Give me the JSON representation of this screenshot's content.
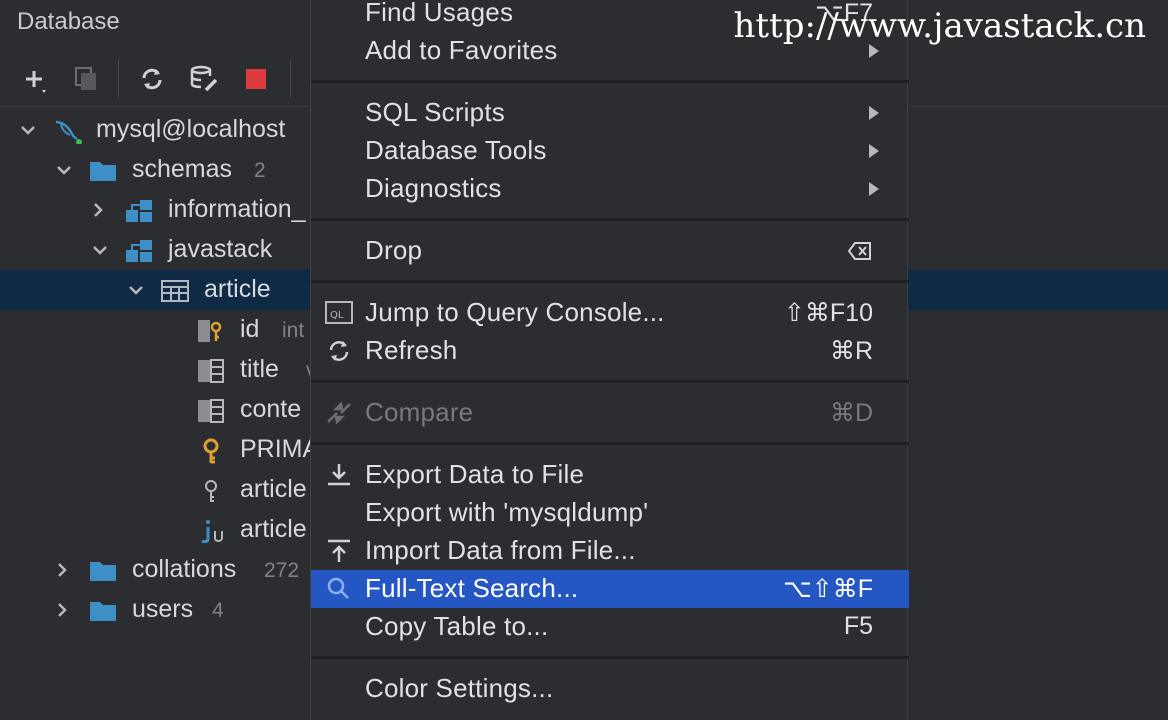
{
  "panel": {
    "title": "Database"
  },
  "watermark": "http://www.javastack.cn",
  "tree": {
    "connection": "mysql@localhost",
    "schemas": {
      "label": "schemas",
      "count": "2"
    },
    "information_schema": "information_",
    "javastack": "javastack",
    "article": "article",
    "columns": [
      {
        "label": "id",
        "type": "int"
      },
      {
        "label": "title",
        "type": "v"
      },
      {
        "label": "conte",
        "type": ""
      }
    ],
    "primary_key": "PRIMA",
    "index1": "article",
    "index2": "article",
    "collations": {
      "label": "collations",
      "count": "272"
    },
    "users": {
      "label": "users",
      "count": "4"
    }
  },
  "menu": {
    "find_usages": {
      "label": "Find Usages",
      "shortcut": "⌥F7"
    },
    "add_to_favorites": {
      "label": "Add to Favorites"
    },
    "sql_scripts": {
      "label": "SQL Scripts"
    },
    "database_tools": {
      "label": "Database Tools"
    },
    "diagnostics": {
      "label": "Diagnostics"
    },
    "drop": {
      "label": "Drop"
    },
    "jump_to_console": {
      "label": "Jump to Query Console...",
      "shortcut": "⇧⌘F10"
    },
    "refresh": {
      "label": "Refresh",
      "shortcut": "⌘R"
    },
    "compare": {
      "label": "Compare",
      "shortcut": "⌘D"
    },
    "export_data": {
      "label": "Export Data to File"
    },
    "export_mysqldump": {
      "label": "Export with 'mysqldump'"
    },
    "import_data": {
      "label": "Import Data from File..."
    },
    "full_text_search": {
      "label": "Full-Text Search...",
      "shortcut": "⌥⇧⌘F"
    },
    "copy_table": {
      "label": "Copy Table to...",
      "shortcut": "F5"
    },
    "color_settings": {
      "label": "Color Settings..."
    }
  },
  "colors": {
    "selection": "#0f2a45",
    "highlight": "#2456c4",
    "folder": "#3d8fc6",
    "key": "#e0a030"
  }
}
